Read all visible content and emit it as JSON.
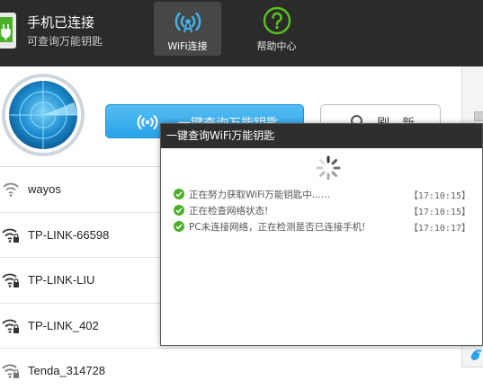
{
  "header": {
    "conn_title": "手机已连接",
    "conn_subtitle": "可查询万能钥匙",
    "tabs": [
      {
        "label": "WiFi连接",
        "icon": "wifi-icon",
        "active": true
      },
      {
        "label": "帮助中心",
        "icon": "question-icon",
        "active": false
      }
    ]
  },
  "actions": {
    "query_label": "一键查询万能钥匙",
    "refresh_label": "刷新"
  },
  "wifi_list": [
    {
      "name": "wayos",
      "locked": false
    },
    {
      "name": "TP-LINK-66598",
      "locked": true
    },
    {
      "name": "TP-LINK-LIU",
      "locked": true
    },
    {
      "name": "TP-LINK_402",
      "locked": true
    },
    {
      "name": "Tenda_314728",
      "locked": true
    }
  ],
  "dialog": {
    "title": "一键查询WiFi万能钥匙",
    "log": [
      {
        "text": "正在努力获取WiFi万能钥匙中......",
        "time": "【17:10:15】"
      },
      {
        "text": "正在检查网络状态!",
        "time": "【17:10:15】"
      },
      {
        "text": "PC未连接网络，正在检测是否已连接手机!",
        "time": "【17:10:17】"
      }
    ]
  },
  "colors": {
    "header_bg": "#2b2b2b",
    "accent_blue": "#2aa3e8",
    "check_green": "#4caf2a",
    "help_green": "#5ac31a"
  }
}
